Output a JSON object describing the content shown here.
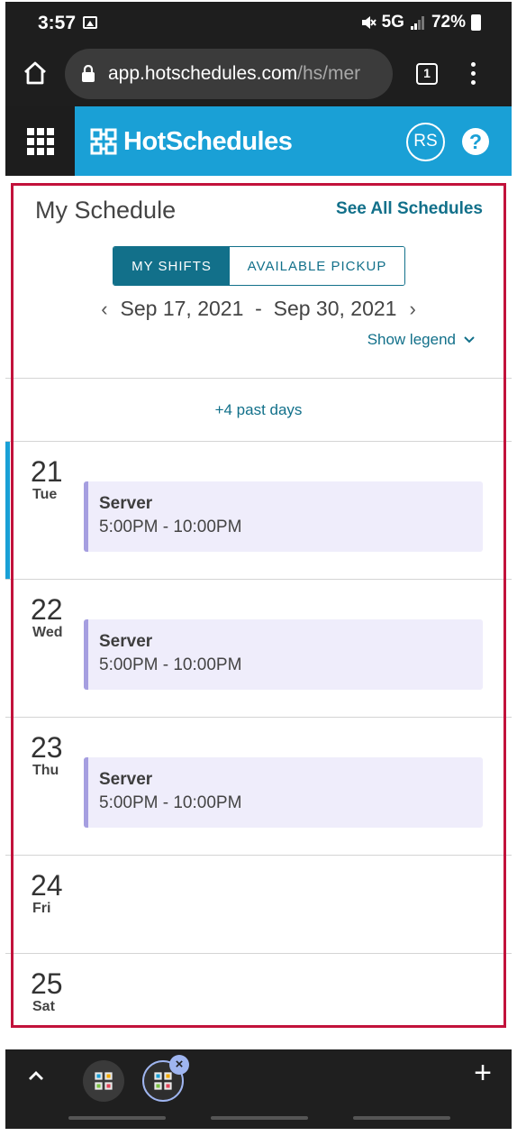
{
  "status_bar": {
    "time": "3:57",
    "network": "5G",
    "battery": "72%",
    "icons": [
      "image-icon",
      "mute-icon",
      "signal-icon",
      "battery-icon"
    ]
  },
  "browser": {
    "url_host": "app.hotschedules.com",
    "url_path": "/hs/mer",
    "tab_count": "1",
    "icons": [
      "home-icon",
      "lock-icon",
      "overflow-menu-icon"
    ]
  },
  "app_header": {
    "brand": "HotSchedules",
    "avatar_initials": "RS",
    "help_label": "?",
    "colors": {
      "brand": "#1aa0d6",
      "accent": "#12708a"
    }
  },
  "schedule": {
    "title": "My Schedule",
    "see_all": "See All Schedules",
    "tabs": [
      {
        "label": "MY SHIFTS",
        "active": true
      },
      {
        "label": "AVAILABLE PICKUP",
        "active": false
      }
    ],
    "range_start": "Sep 17, 2021",
    "range_sep": "-",
    "range_end": "Sep 30, 2021",
    "show_legend": "Show legend",
    "past_days": "+4 past days",
    "days": [
      {
        "num": "21",
        "dow": "Tue",
        "today": true,
        "shift": {
          "role": "Server",
          "time": "5:00PM - 10:00PM"
        }
      },
      {
        "num": "22",
        "dow": "Wed",
        "today": false,
        "shift": {
          "role": "Server",
          "time": "5:00PM - 10:00PM"
        }
      },
      {
        "num": "23",
        "dow": "Thu",
        "today": false,
        "shift": {
          "role": "Server",
          "time": "5:00PM - 10:00PM"
        }
      },
      {
        "num": "24",
        "dow": "Fri",
        "today": false,
        "shift": null
      },
      {
        "num": "25",
        "dow": "Sat",
        "today": false,
        "shift": null
      }
    ]
  },
  "bottom_bar": {
    "close_label": "×",
    "plus_label": "+"
  }
}
